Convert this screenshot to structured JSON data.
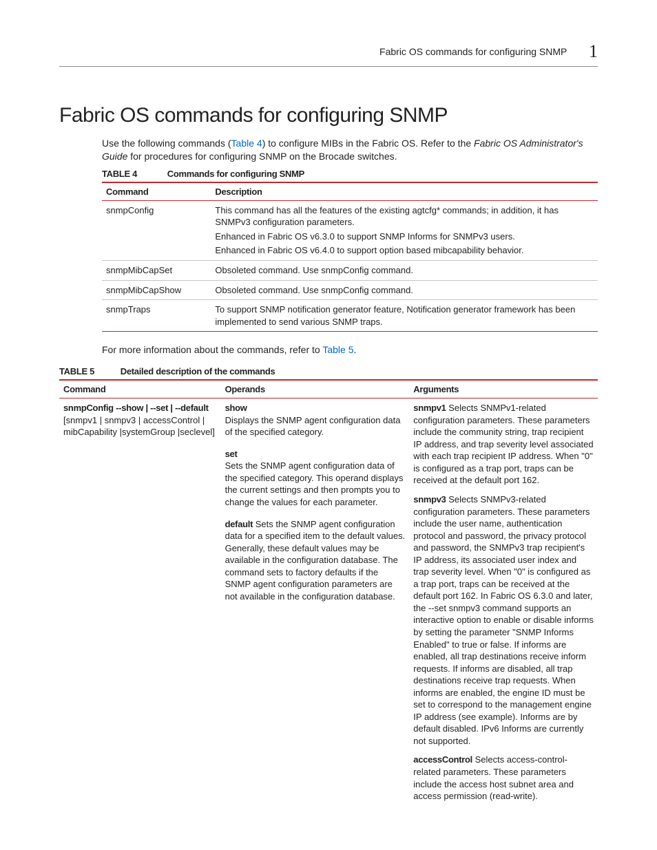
{
  "header": {
    "running_title": "Fabric OS commands for configuring SNMP",
    "chapter_number": "1"
  },
  "section": {
    "title": "Fabric OS commands for configuring SNMP",
    "intro_pre": "Use the following commands (",
    "intro_xref": "Table 4",
    "intro_mid": ") to configure MIBs in the Fabric OS. Refer to the ",
    "intro_em": "Fabric OS Administrator's Guide",
    "intro_post": " for procedures for configuring SNMP on the Brocade switches."
  },
  "table4": {
    "label": "TABLE 4",
    "title": "Commands for configuring SNMP",
    "col1": "Command",
    "col2": "Description",
    "rows": [
      {
        "cmd": "snmpConfig",
        "desc": [
          "This command has all the features of the existing agtcfg* commands; in addition, it has SNMPv3 configuration parameters.",
          "Enhanced in Fabric OS v6.3.0 to support SNMP Informs for SNMPv3 users.",
          "Enhanced in Fabric OS v6.4.0 to support option based mibcapability behavior."
        ]
      },
      {
        "cmd": "snmpMibCapSet",
        "desc": [
          "Obsoleted command. Use snmpConfig command."
        ]
      },
      {
        "cmd": "snmpMibCapShow",
        "desc": [
          "Obsoleted command. Use snmpConfig command."
        ]
      },
      {
        "cmd": "snmpTraps",
        "desc": [
          "To support SNMP notification generator feature, Notification generator framework has been implemented to send various SNMP traps."
        ]
      }
    ]
  },
  "between": {
    "pre": "For more information about the commands, refer to ",
    "xref": "Table 5",
    "post": "."
  },
  "table5": {
    "label": "TABLE 5",
    "title": "Detailed description of the commands",
    "col1": "Command",
    "col2": "Operands",
    "col3": "Arguments",
    "row": {
      "command_main": "snmpConfig --show | --set | --default",
      "command_opts": "[snmpv1 | snmpv3 | accessControl | mibCapability |systemGroup |seclevel]",
      "operands": [
        {
          "name": "show",
          "text": "Displays the SNMP agent configuration data of the specified category.",
          "inline": false
        },
        {
          "name": "set",
          "text": "Sets the SNMP agent configuration data of the specified category. This operand displays the current settings and then prompts you to change the values for each parameter.",
          "inline": false
        },
        {
          "name": "default",
          "text": "Sets the SNMP agent configuration data for a specified item to the default values. Generally, these default values may be available in the configuration database. The command sets to factory defaults if the SNMP agent configuration parameters are not available in the configuration database.",
          "inline": true
        }
      ],
      "arguments": [
        {
          "name": "snmpv1",
          "text": "Selects SNMPv1-related configuration parameters. These parameters include the community string, trap recipient IP address, and trap severity level associated with each trap recipient IP address. When \"0\" is configured as a trap port, traps can be received at the default port 162."
        },
        {
          "name": "snmpv3",
          "text": "Selects SNMPv3-related configuration parameters. These parameters include the user name, authentication protocol and password, the privacy protocol and password, the SNMPv3 trap recipient's IP address, its associated user index and trap severity level. When \"0\" is configured as a trap port, traps can be received at the default port 162. In Fabric OS 6.3.0 and later, the --set snmpv3 command supports an interactive option to enable or disable informs by setting the parameter \"SNMP Informs Enabled\" to true or false. If informs are enabled, all trap destinations receive inform requests. If informs are disabled, all trap destinations receive trap requests. When informs are enabled, the engine ID must be set to correspond to the management engine IP address (see example). Informs are by default disabled. IPv6 Informs are currently not supported."
        },
        {
          "name": "accessControl",
          "text": "Selects access-control-related parameters. These parameters include the access host subnet area and access permission (read-write)."
        }
      ]
    }
  }
}
